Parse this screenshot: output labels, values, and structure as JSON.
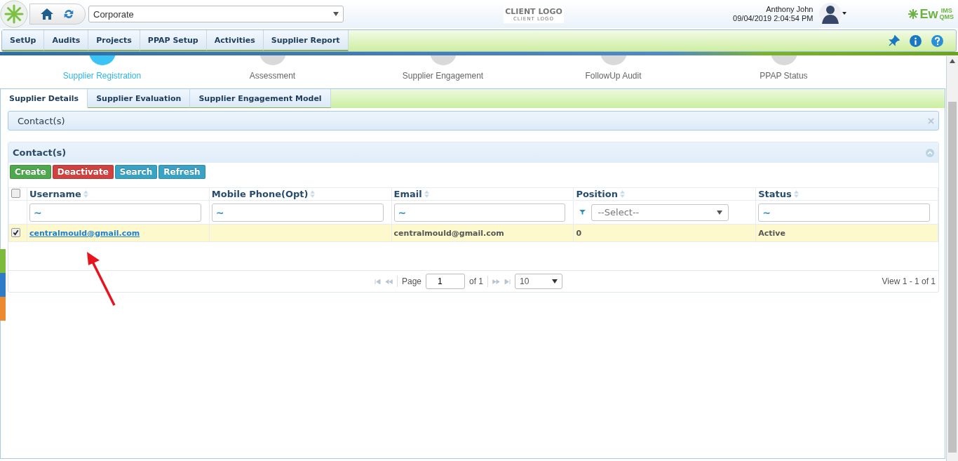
{
  "header": {
    "company": "Corporate",
    "client_logo": {
      "main": "CLIENT LOGO",
      "sub": "CLIENT LOGO"
    },
    "user": {
      "name": "Anthony John",
      "datetime": "09/04/2019 2:04:54 PM"
    },
    "brand": {
      "main": "Ew",
      "sub": "QMS",
      "super": "IMS"
    }
  },
  "menu": [
    {
      "label": "SetUp"
    },
    {
      "label": "Audits"
    },
    {
      "label": "Projects"
    },
    {
      "label": "PPAP Setup"
    },
    {
      "label": "Activities"
    },
    {
      "label": "Supplier Report"
    }
  ],
  "steps": [
    {
      "label": "Supplier Registration",
      "selected": true
    },
    {
      "label": "Assessment",
      "selected": false
    },
    {
      "label": "Supplier Engagement",
      "selected": false
    },
    {
      "label": "FollowUp Audit",
      "selected": false
    },
    {
      "label": "PPAP Status",
      "selected": false
    }
  ],
  "tabs": [
    {
      "label": "Supplier Details",
      "selected": true
    },
    {
      "label": "Supplier Evaluation",
      "selected": false
    },
    {
      "label": "Supplier Engagement Model",
      "selected": false
    }
  ],
  "collapsed_panel": {
    "title": "Contact(s)"
  },
  "grid": {
    "title": "Contact(s)",
    "select_all_checked": false,
    "buttons": [
      {
        "label": "Create",
        "kind": "success"
      },
      {
        "label": "Deactivate",
        "kind": "danger"
      },
      {
        "label": "Search",
        "kind": "info"
      },
      {
        "label": "Refresh",
        "kind": "info"
      }
    ],
    "columns": [
      {
        "label": "Username",
        "filter": {
          "kind": "text",
          "value": "~"
        }
      },
      {
        "label": "Mobile Phone(Opt)",
        "filter": {
          "kind": "text",
          "value": "~"
        }
      },
      {
        "label": "Email",
        "filter": {
          "kind": "text",
          "value": "~"
        }
      },
      {
        "label": "Position",
        "filter": {
          "kind": "select",
          "value": "--Select--"
        }
      },
      {
        "label": "Status",
        "filter": {
          "kind": "text",
          "value": "~"
        }
      }
    ],
    "rows": [
      {
        "checked": true,
        "selected": true,
        "cells": [
          "centralmould@gmail.com",
          "",
          "centralmould@gmail.com",
          "0",
          "Active"
        ]
      }
    ],
    "pager": {
      "page_label": "Page",
      "page": "1",
      "of": "of 1",
      "page_size": "10",
      "summary": "View 1 - 1 of 1"
    }
  }
}
